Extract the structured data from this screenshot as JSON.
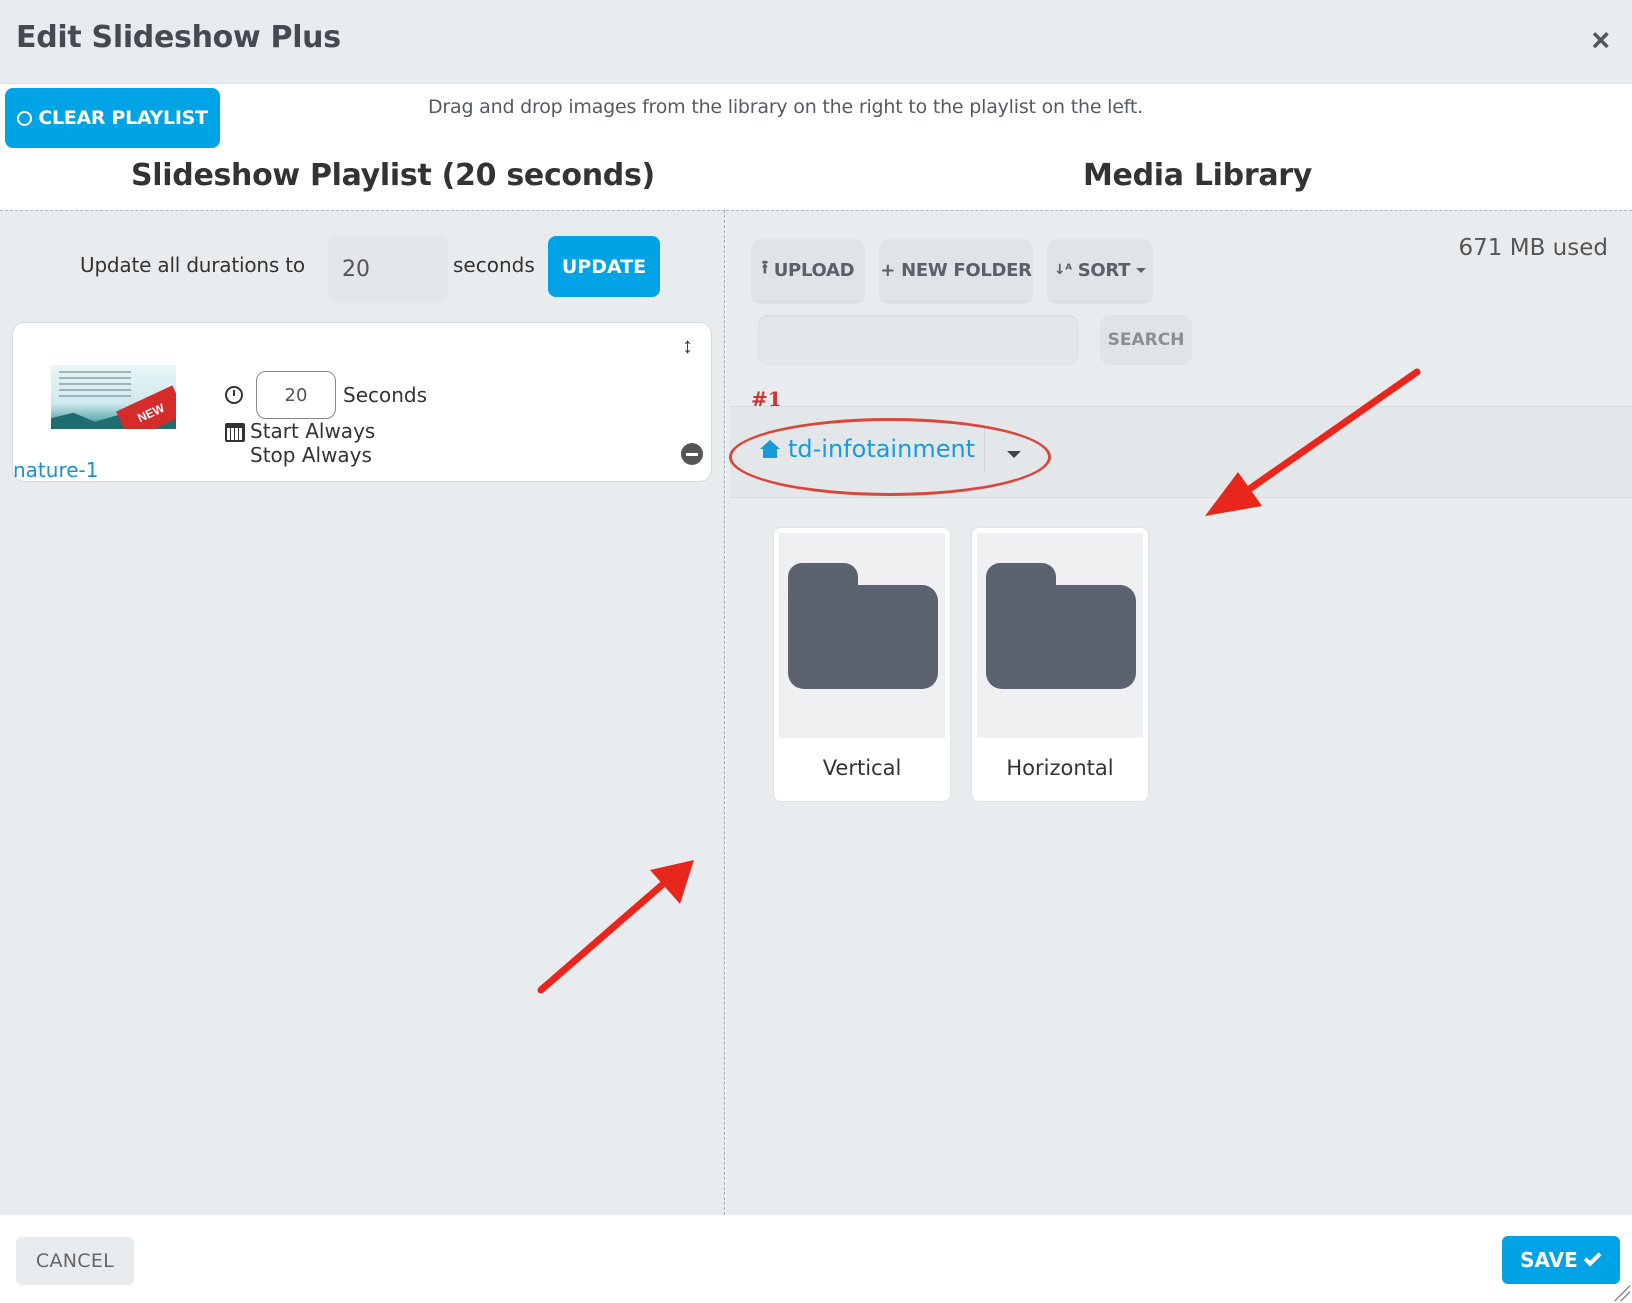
{
  "dialog": {
    "title": "Edit Slideshow Plus",
    "close_label": "×"
  },
  "toolbar": {
    "clear_playlist_label": "CLEAR PLAYLIST",
    "hint": "Drag and drop images from the library on the right to the playlist on the left."
  },
  "playlist": {
    "title": "Slideshow Playlist (20 seconds)",
    "update_all_label": "Update all durations to",
    "update_all_value": "20",
    "update_all_unit": "seconds",
    "update_label": "UPDATE",
    "items": [
      {
        "name": "nature-1",
        "duration": "20",
        "duration_unit": "Seconds",
        "start": "Start Always",
        "stop": "Stop Always",
        "thumb_badge": "NEW"
      }
    ]
  },
  "library": {
    "title": "Media Library",
    "upload_label": "UPLOAD",
    "new_folder_label": "NEW FOLDER",
    "sort_label": "SORT",
    "storage_used": "671 MB used",
    "search_placeholder": "",
    "search_label": "SEARCH",
    "current_folder": "td-infotainment",
    "folders": [
      {
        "name": "Vertical"
      },
      {
        "name": "Horizontal"
      }
    ]
  },
  "annotations": {
    "marker_label": "#1",
    "color": "#d9463a"
  },
  "footer": {
    "cancel_label": "CANCEL",
    "save_label": "SAVE"
  },
  "colors": {
    "accent": "#00a3e6",
    "link": "#1a9ad8",
    "panel_bg": "#e9ecef",
    "folder_icon": "#5c6270"
  }
}
